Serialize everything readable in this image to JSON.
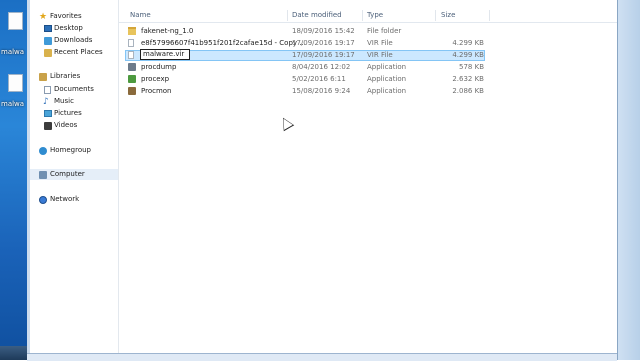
{
  "desktop": {
    "icons": [
      {
        "label": "malwa",
        "name": "malware-desktop-icon-1"
      },
      {
        "label": "malwa",
        "name": "malware-desktop-icon-2"
      }
    ]
  },
  "nav": {
    "favorites": "Favorites",
    "desktop": "Desktop",
    "downloads": "Downloads",
    "recent": "Recent Places",
    "libraries": "Libraries",
    "documents": "Documents",
    "music": "Music",
    "pictures": "Pictures",
    "videos": "Videos",
    "homegroup": "Homegroup",
    "computer": "Computer",
    "network": "Network"
  },
  "columns": {
    "name": "Name",
    "date": "Date modified",
    "type": "Type",
    "size": "Size"
  },
  "files": [
    {
      "name": "fakenet-ng_1.0",
      "date": "18/09/2016 15:42",
      "type": "File folder",
      "size": "",
      "icon": "folder-icon"
    },
    {
      "name": "e8f57996607f41b951f201f2cafae15d - Copy ...",
      "date": "17/09/2016 19:17",
      "type": "VIR File",
      "size": "4.299 KB",
      "icon": "file-icon"
    },
    {
      "name": "malware.vir",
      "date": "17/09/2016 19:17",
      "type": "VIR File",
      "size": "4.299 KB",
      "icon": "file-icon"
    },
    {
      "name": "procdump",
      "date": "8/04/2016 12:02",
      "type": "Application",
      "size": "578 KB",
      "icon": "app-icon"
    },
    {
      "name": "procexp",
      "date": "5/02/2016 6:11",
      "type": "Application",
      "size": "2.632 KB",
      "icon": "app-icon"
    },
    {
      "name": "Procmon",
      "date": "15/08/2016 9:24",
      "type": "Application",
      "size": "2.086 KB",
      "icon": "app-icon"
    }
  ]
}
